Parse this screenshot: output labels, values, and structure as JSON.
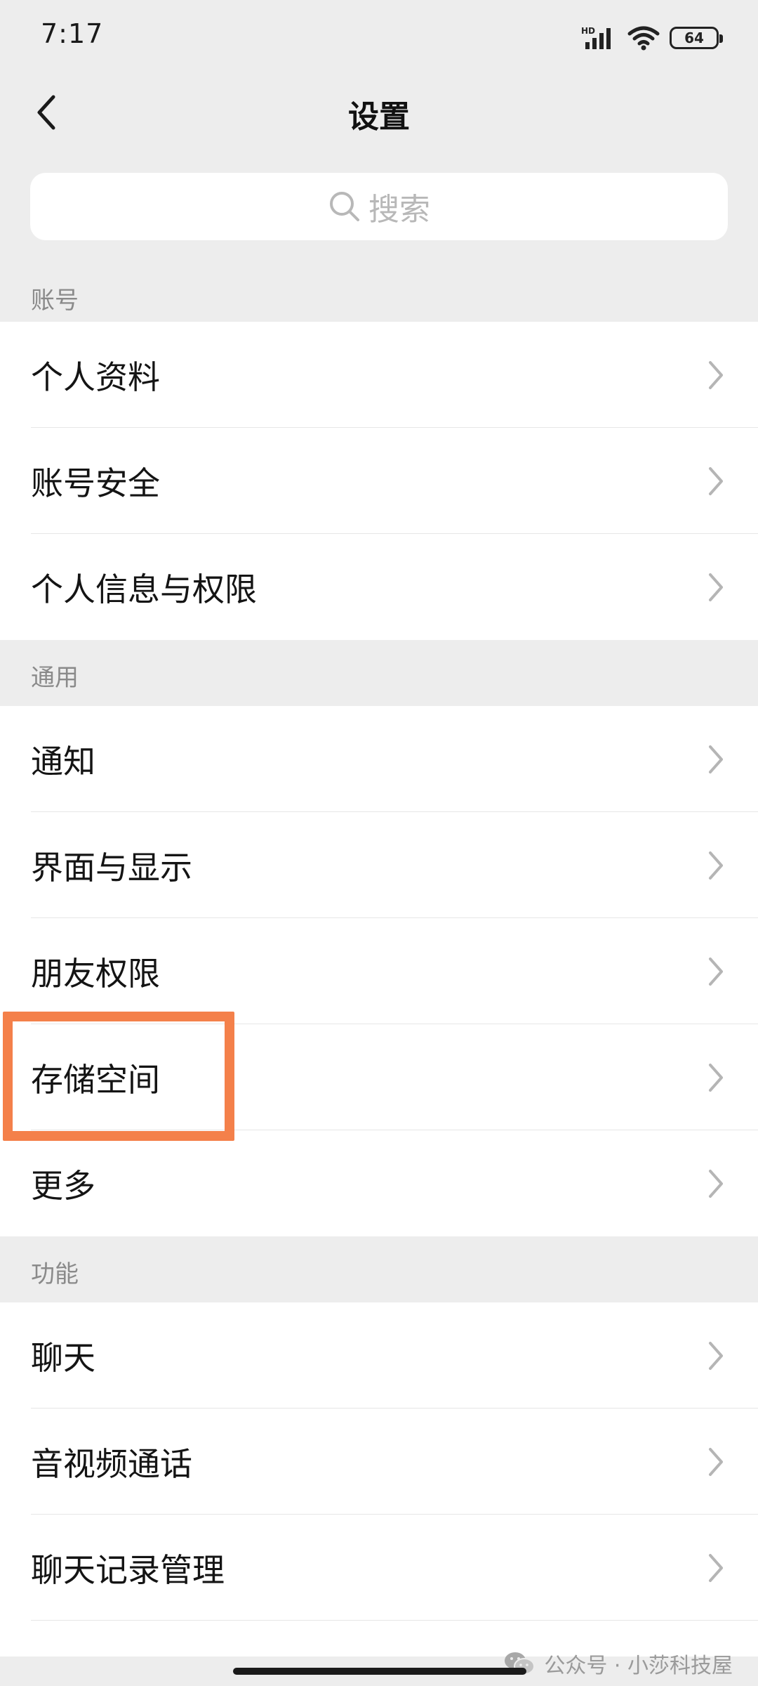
{
  "status_bar": {
    "time": "7:17",
    "network_label": "HD",
    "battery_level": "64"
  },
  "nav": {
    "title": "设置"
  },
  "search": {
    "placeholder": "搜索"
  },
  "sections": [
    {
      "header": "账号",
      "items": [
        "个人资料",
        "账号安全",
        "个人信息与权限"
      ]
    },
    {
      "header": "通用",
      "items": [
        "通知",
        "界面与显示",
        "朋友权限",
        "存储空间",
        "更多"
      ]
    },
    {
      "header": "功能",
      "items": [
        "聊天",
        "音视频通话",
        "聊天记录管理"
      ]
    }
  ],
  "highlight": {
    "target": "存储空间",
    "color": "#f4804a"
  },
  "watermark": {
    "text": "公众号 · 小莎科技屋"
  },
  "colors": {
    "background": "#ededed",
    "card": "#ffffff",
    "section_text": "#8a8a8a",
    "chevron": "#b5b5b5"
  }
}
